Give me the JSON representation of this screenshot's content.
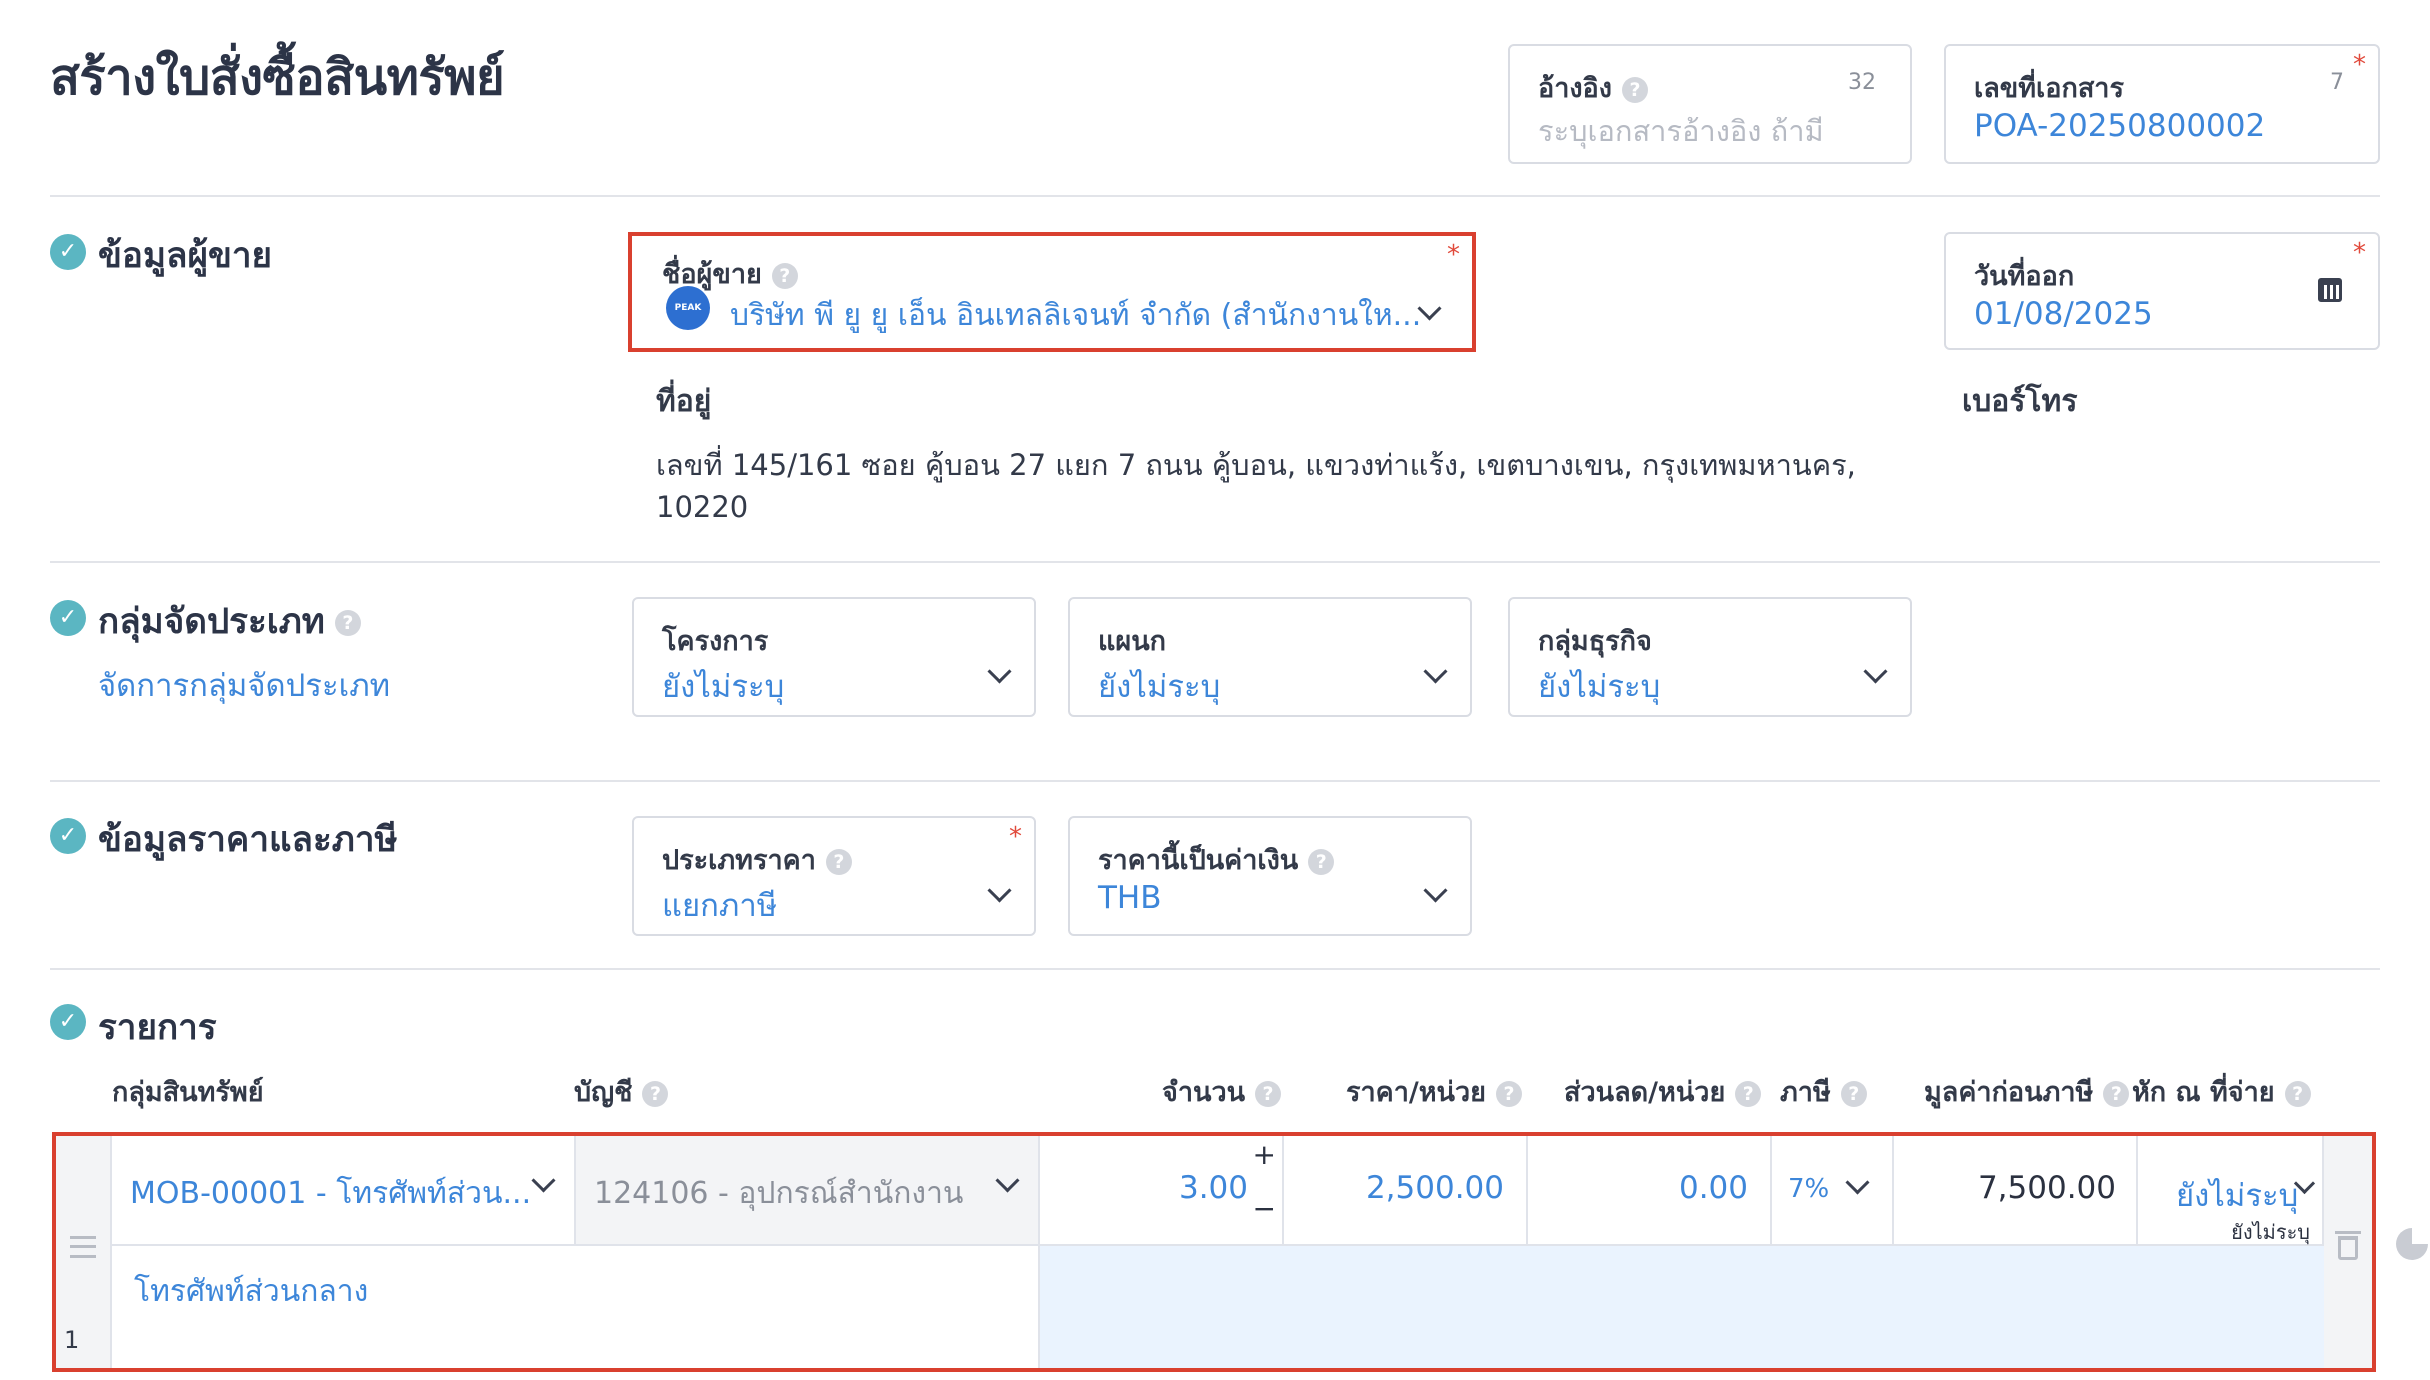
{
  "page": {
    "title": "สร้างใบสั่งซื้อสินทรัพย์"
  },
  "header": {
    "reference": {
      "label": "อ้างอิง",
      "counter": "32",
      "placeholder": "ระบุเอกสารอ้างอิง ถ้ามี"
    },
    "doc_number": {
      "label": "เลขที่เอกสาร",
      "counter": "7",
      "value": "POA-20250800002",
      "required": "*"
    }
  },
  "vendor": {
    "section_title": "ข้อมูลผู้ขาย",
    "name_label": "ชื่อผู้ขาย",
    "name_value": "บริษัท พี ยู ยู เอ็น อินเทลลิเจนท์ จำกัด (สำนักงานให...",
    "logo_text": "PEAK",
    "required": "*",
    "address_label": "ที่อยู่",
    "address_line1": "เลขที่ 145/161 ซอย คู้บอน 27 แยก 7 ถนน คู้บอน, แขวงท่าแร้ง, เขตบางเขน, กรุงเทพมหานคร,",
    "address_line2": "10220",
    "issue_date_label": "วันที่ออก",
    "issue_date_value": "01/08/2025",
    "phone_label": "เบอร์โทร"
  },
  "classification": {
    "section_title": "กลุ่มจัดประเภท",
    "manage_link": "จัดการกลุ่มจัดประเภท",
    "project": {
      "label": "โครงการ",
      "value": "ยังไม่ระบุ"
    },
    "department": {
      "label": "แผนก",
      "value": "ยังไม่ระบุ"
    },
    "business_group": {
      "label": "กลุ่มธุรกิจ",
      "value": "ยังไม่ระบุ"
    }
  },
  "pricing": {
    "section_title": "ข้อมูลราคาและภาษี",
    "price_type": {
      "label": "ประเภทราคา",
      "value": "แยกภาษี",
      "required": "*"
    },
    "currency": {
      "label": "ราคานี้เป็นค่าเงิน",
      "value": "THB"
    }
  },
  "items": {
    "section_title": "รายการ",
    "columns": {
      "asset_group": "กลุ่มสินทรัพย์",
      "account": "บัญชี",
      "qty": "จำนวน",
      "unit_price": "ราคา/หน่วย",
      "discount": "ส่วนลด/หน่วย",
      "tax": "ภาษี",
      "pre_tax": "มูลค่าก่อนภาษี",
      "withholding": "หัก ณ ที่จ่าย"
    },
    "row": {
      "index": "1",
      "asset_group": "MOB-00001 - โทรศัพท์ส่วน...",
      "account": "124106 - อุปกรณ์สำนักงาน",
      "qty": "3.00",
      "unit_price": "2,500.00",
      "discount": "0.00",
      "tax": "7%",
      "pre_tax": "7,500.00",
      "withholding": "ยังไม่ระบุ",
      "withholding_sub": "ยังไม่ระบุ",
      "description": "โทรศัพท์ส่วนกลาง"
    }
  },
  "colors": {
    "accent": "#3d86d9",
    "check": "#5bb6c2",
    "highlight": "#d9402f",
    "row_fill": "#eaf3fe"
  }
}
